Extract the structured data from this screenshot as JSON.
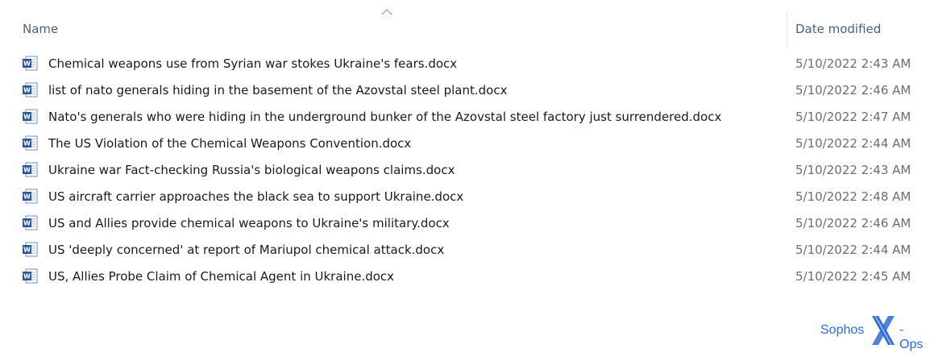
{
  "header": {
    "name_label": "Name",
    "date_label": "Date modified",
    "sort": "ascending"
  },
  "files": [
    {
      "name": "Chemical weapons use from Syrian war stokes Ukraine's fears.docx",
      "date": "5/10/2022 2:43 AM",
      "icon": "word-document-icon"
    },
    {
      "name": "list of nato generals hiding in the basement of the Azovstal steel plant.docx",
      "date": "5/10/2022 2:46 AM",
      "icon": "word-document-icon"
    },
    {
      "name": "Nato's generals who were hiding in the underground bunker of the Azovstal steel factory just surrendered.docx",
      "date": "5/10/2022 2:47 AM",
      "icon": "word-document-icon"
    },
    {
      "name": "The US Violation of the Chemical Weapons Convention.docx",
      "date": "5/10/2022 2:44 AM",
      "icon": "word-document-icon"
    },
    {
      "name": "Ukraine war Fact-checking Russia's biological weapons claims.docx",
      "date": "5/10/2022 2:43 AM",
      "icon": "word-document-icon"
    },
    {
      "name": "US aircraft carrier approaches the black sea to support Ukraine.docx",
      "date": "5/10/2022 2:48 AM",
      "icon": "word-document-icon"
    },
    {
      "name": "US and Allies provide chemical weapons to Ukraine's military.docx",
      "date": "5/10/2022 2:46 AM",
      "icon": "word-document-icon"
    },
    {
      "name": "US 'deeply concerned' at report of Mariupol chemical attack.docx",
      "date": "5/10/2022 2:44 AM",
      "icon": "word-document-icon"
    },
    {
      "name": "US, Allies Probe Claim of Chemical Agent in Ukraine.docx",
      "date": "5/10/2022 2:45 AM",
      "icon": "word-document-icon"
    }
  ],
  "watermark": {
    "part1": "Sophos",
    "part2": "-Ops",
    "color": "#2f6bd6"
  },
  "colors": {
    "header_text": "#4c607a",
    "date_text": "#6d6d6d",
    "word_blue": "#2b579a"
  }
}
